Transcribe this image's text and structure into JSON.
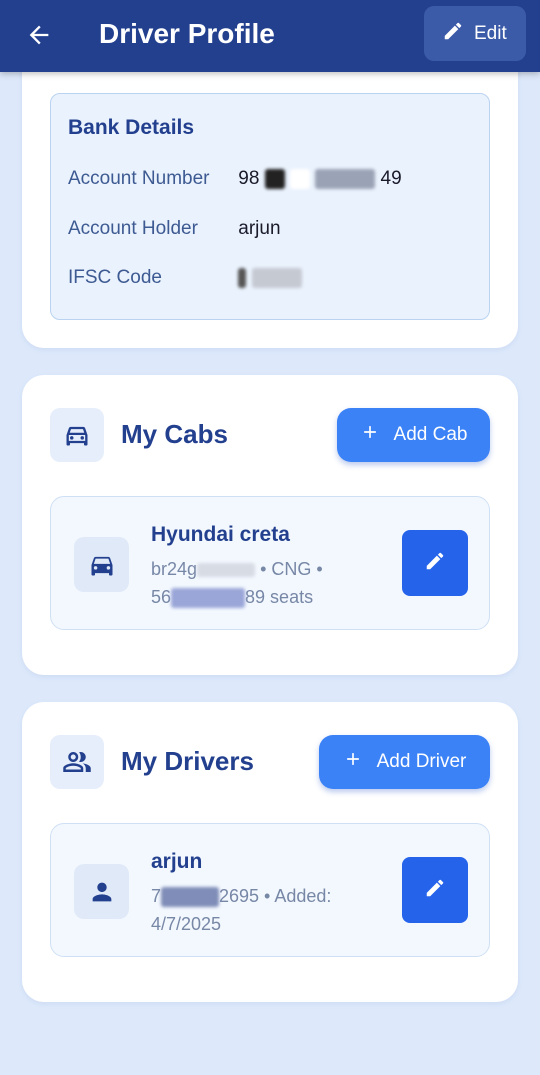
{
  "appbar": {
    "title": "Driver Profile",
    "edit_label": "Edit"
  },
  "bank": {
    "title": "Bank Details",
    "rows": [
      {
        "label": "Account Number",
        "value_start": "98",
        "value_end": "49"
      },
      {
        "label": "Account Holder",
        "value_start": "arjun",
        "value_end": ""
      },
      {
        "label": "IFSC Code",
        "value_start": "",
        "value_end": ""
      }
    ]
  },
  "cabs": {
    "title": "My Cabs",
    "add_label": "Add Cab",
    "items": [
      {
        "name": "Hyundai creta",
        "line1_start": "br24g",
        "line1_end": "• CNG •",
        "line2_start": "56",
        "line2_end": "89 seats"
      }
    ]
  },
  "drivers": {
    "title": "My Drivers",
    "add_label": "Add Driver",
    "items": [
      {
        "name": "arjun",
        "line1_start": "7",
        "line1_end": "2695 • Added:",
        "line2": "4/7/2025"
      }
    ]
  },
  "colors": {
    "primary": "#23408f",
    "accent": "#3b82f6",
    "edit_square": "#2563eb",
    "background": "#dde9fb"
  }
}
